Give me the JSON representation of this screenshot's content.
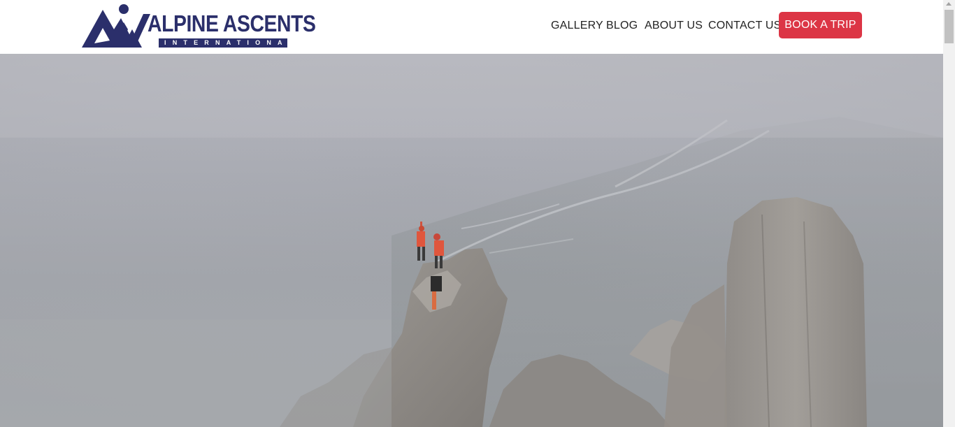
{
  "header": {
    "logo": {
      "title": "ALPINE ASCENTS",
      "subtitle": "INTERNATIONAL",
      "icon": "mountain-logo-icon",
      "color": "#2b2f6b"
    },
    "nav": {
      "gallery": "GALLERY",
      "blog": "BLOG",
      "about": "ABOUT US",
      "contact": "CONTACT US"
    },
    "cta": {
      "label": "BOOK A TRIP",
      "color": "#dc3545"
    }
  },
  "hero": {
    "image": "misty-rock-spire-climbers-photo"
  },
  "scrollbar": {
    "icon": "scroll-up-arrow-icon"
  }
}
